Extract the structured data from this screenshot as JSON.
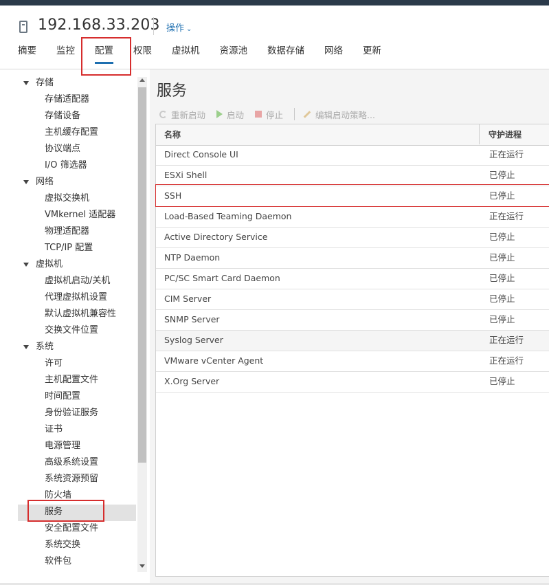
{
  "header": {
    "host_title": "192.168.33.203",
    "actions_label": "操作",
    "host_icon": "host-icon"
  },
  "tabs": [
    {
      "label": "摘要",
      "active": false
    },
    {
      "label": "监控",
      "active": false
    },
    {
      "label": "配置",
      "active": true
    },
    {
      "label": "权限",
      "active": false
    },
    {
      "label": "虚拟机",
      "active": false
    },
    {
      "label": "资源池",
      "active": false
    },
    {
      "label": "数据存储",
      "active": false
    },
    {
      "label": "网络",
      "active": false
    },
    {
      "label": "更新",
      "active": false
    }
  ],
  "sidebar": {
    "items": [
      {
        "label": "存储",
        "type": "category"
      },
      {
        "label": "存储适配器",
        "type": "sub"
      },
      {
        "label": "存储设备",
        "type": "sub"
      },
      {
        "label": "主机缓存配置",
        "type": "sub"
      },
      {
        "label": "协议端点",
        "type": "sub"
      },
      {
        "label": "I/O 筛选器",
        "type": "sub"
      },
      {
        "label": "网络",
        "type": "category"
      },
      {
        "label": "虚拟交换机",
        "type": "sub"
      },
      {
        "label": "VMkernel 适配器",
        "type": "sub"
      },
      {
        "label": "物理适配器",
        "type": "sub"
      },
      {
        "label": "TCP/IP 配置",
        "type": "sub"
      },
      {
        "label": "虚拟机",
        "type": "category"
      },
      {
        "label": "虚拟机启动/关机",
        "type": "sub"
      },
      {
        "label": "代理虚拟机设置",
        "type": "sub"
      },
      {
        "label": "默认虚拟机兼容性",
        "type": "sub"
      },
      {
        "label": "交换文件位置",
        "type": "sub"
      },
      {
        "label": "系统",
        "type": "category"
      },
      {
        "label": "许可",
        "type": "sub"
      },
      {
        "label": "主机配置文件",
        "type": "sub"
      },
      {
        "label": "时间配置",
        "type": "sub"
      },
      {
        "label": "身份验证服务",
        "type": "sub"
      },
      {
        "label": "证书",
        "type": "sub"
      },
      {
        "label": "电源管理",
        "type": "sub"
      },
      {
        "label": "高级系统设置",
        "type": "sub"
      },
      {
        "label": "系统资源预留",
        "type": "sub"
      },
      {
        "label": "防火墙",
        "type": "sub"
      },
      {
        "label": "服务",
        "type": "sub",
        "selected": true
      },
      {
        "label": "安全配置文件",
        "type": "sub"
      },
      {
        "label": "系统交换",
        "type": "sub"
      },
      {
        "label": "软件包",
        "type": "sub"
      }
    ]
  },
  "main": {
    "title": "服务",
    "toolbar": {
      "restart": "重新启动",
      "start": "启动",
      "stop": "停止",
      "edit_policy": "编辑启动策略..."
    },
    "columns": {
      "name": "名称",
      "daemon": "守护进程"
    },
    "rows": [
      {
        "name": "Direct Console UI",
        "status": "正在运行"
      },
      {
        "name": "ESXi Shell",
        "status": "已停止"
      },
      {
        "name": "SSH",
        "status": "已停止"
      },
      {
        "name": "Load-Based Teaming Daemon",
        "status": "正在运行"
      },
      {
        "name": "Active Directory Service",
        "status": "已停止"
      },
      {
        "name": "NTP Daemon",
        "status": "已停止"
      },
      {
        "name": "PC/SC Smart Card Daemon",
        "status": "已停止"
      },
      {
        "name": "CIM Server",
        "status": "已停止"
      },
      {
        "name": "SNMP Server",
        "status": "已停止"
      },
      {
        "name": "Syslog Server",
        "status": "正在运行"
      },
      {
        "name": "VMware vCenter Agent",
        "status": "正在运行"
      },
      {
        "name": "X.Org Server",
        "status": "已停止"
      }
    ]
  },
  "colors": {
    "accent": "#1e6fb0",
    "highlight_box": "#d62d2d",
    "topbar": "#2b3a4a"
  }
}
